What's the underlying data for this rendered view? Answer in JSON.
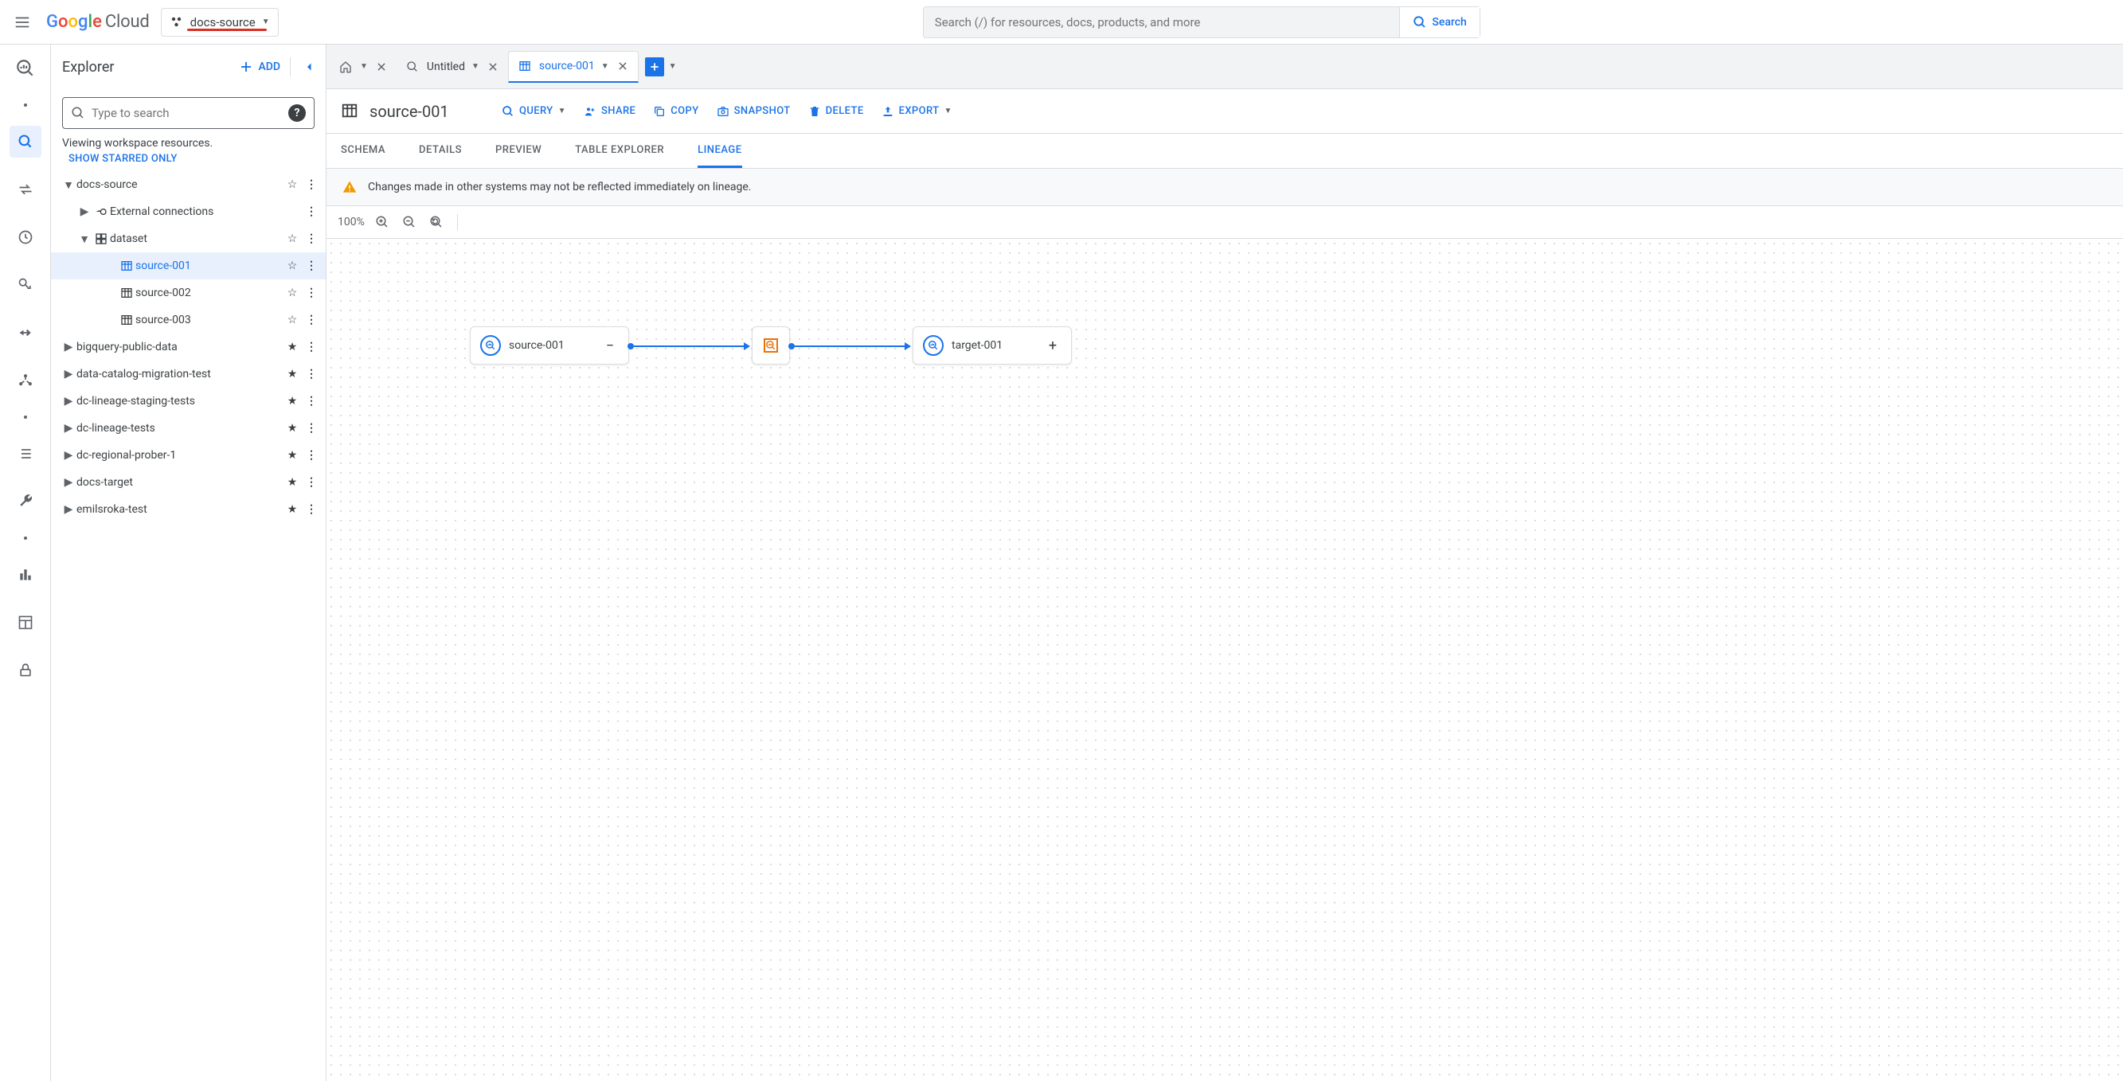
{
  "header": {
    "logo_cloud": "Cloud",
    "project_name": "docs-source",
    "search_placeholder": "Search (/) for resources, docs, products, and more",
    "search_button": "Search"
  },
  "explorer": {
    "title": "Explorer",
    "add": "ADD",
    "search_placeholder": "Type to search",
    "viewing": "Viewing workspace resources.",
    "show_starred": "SHOW STARRED ONLY",
    "tree": {
      "project": "docs-source",
      "external": "External connections",
      "dataset": "dataset",
      "tables": [
        "source-001",
        "source-002",
        "source-003"
      ],
      "other_projects": [
        "bigquery-public-data",
        "data-catalog-migration-test",
        "dc-lineage-staging-tests",
        "dc-lineage-tests",
        "dc-regional-prober-1",
        "docs-target",
        "emilsroka-test"
      ]
    }
  },
  "tabs": {
    "untitled": "Untitled",
    "source001": "source-001"
  },
  "table": {
    "name": "source-001",
    "actions": {
      "query": "QUERY",
      "share": "SHARE",
      "copy": "COPY",
      "snapshot": "SNAPSHOT",
      "delete": "DELETE",
      "export": "EXPORT"
    },
    "subtabs": {
      "schema": "SCHEMA",
      "details": "DETAILS",
      "preview": "PREVIEW",
      "explorer": "TABLE EXPLORER",
      "lineage": "LINEAGE"
    }
  },
  "warning": "Changes made in other systems may not be reflected immediately on lineage.",
  "lineage": {
    "zoom": "100%",
    "source_node": "source-001",
    "target_node": "target-001"
  }
}
